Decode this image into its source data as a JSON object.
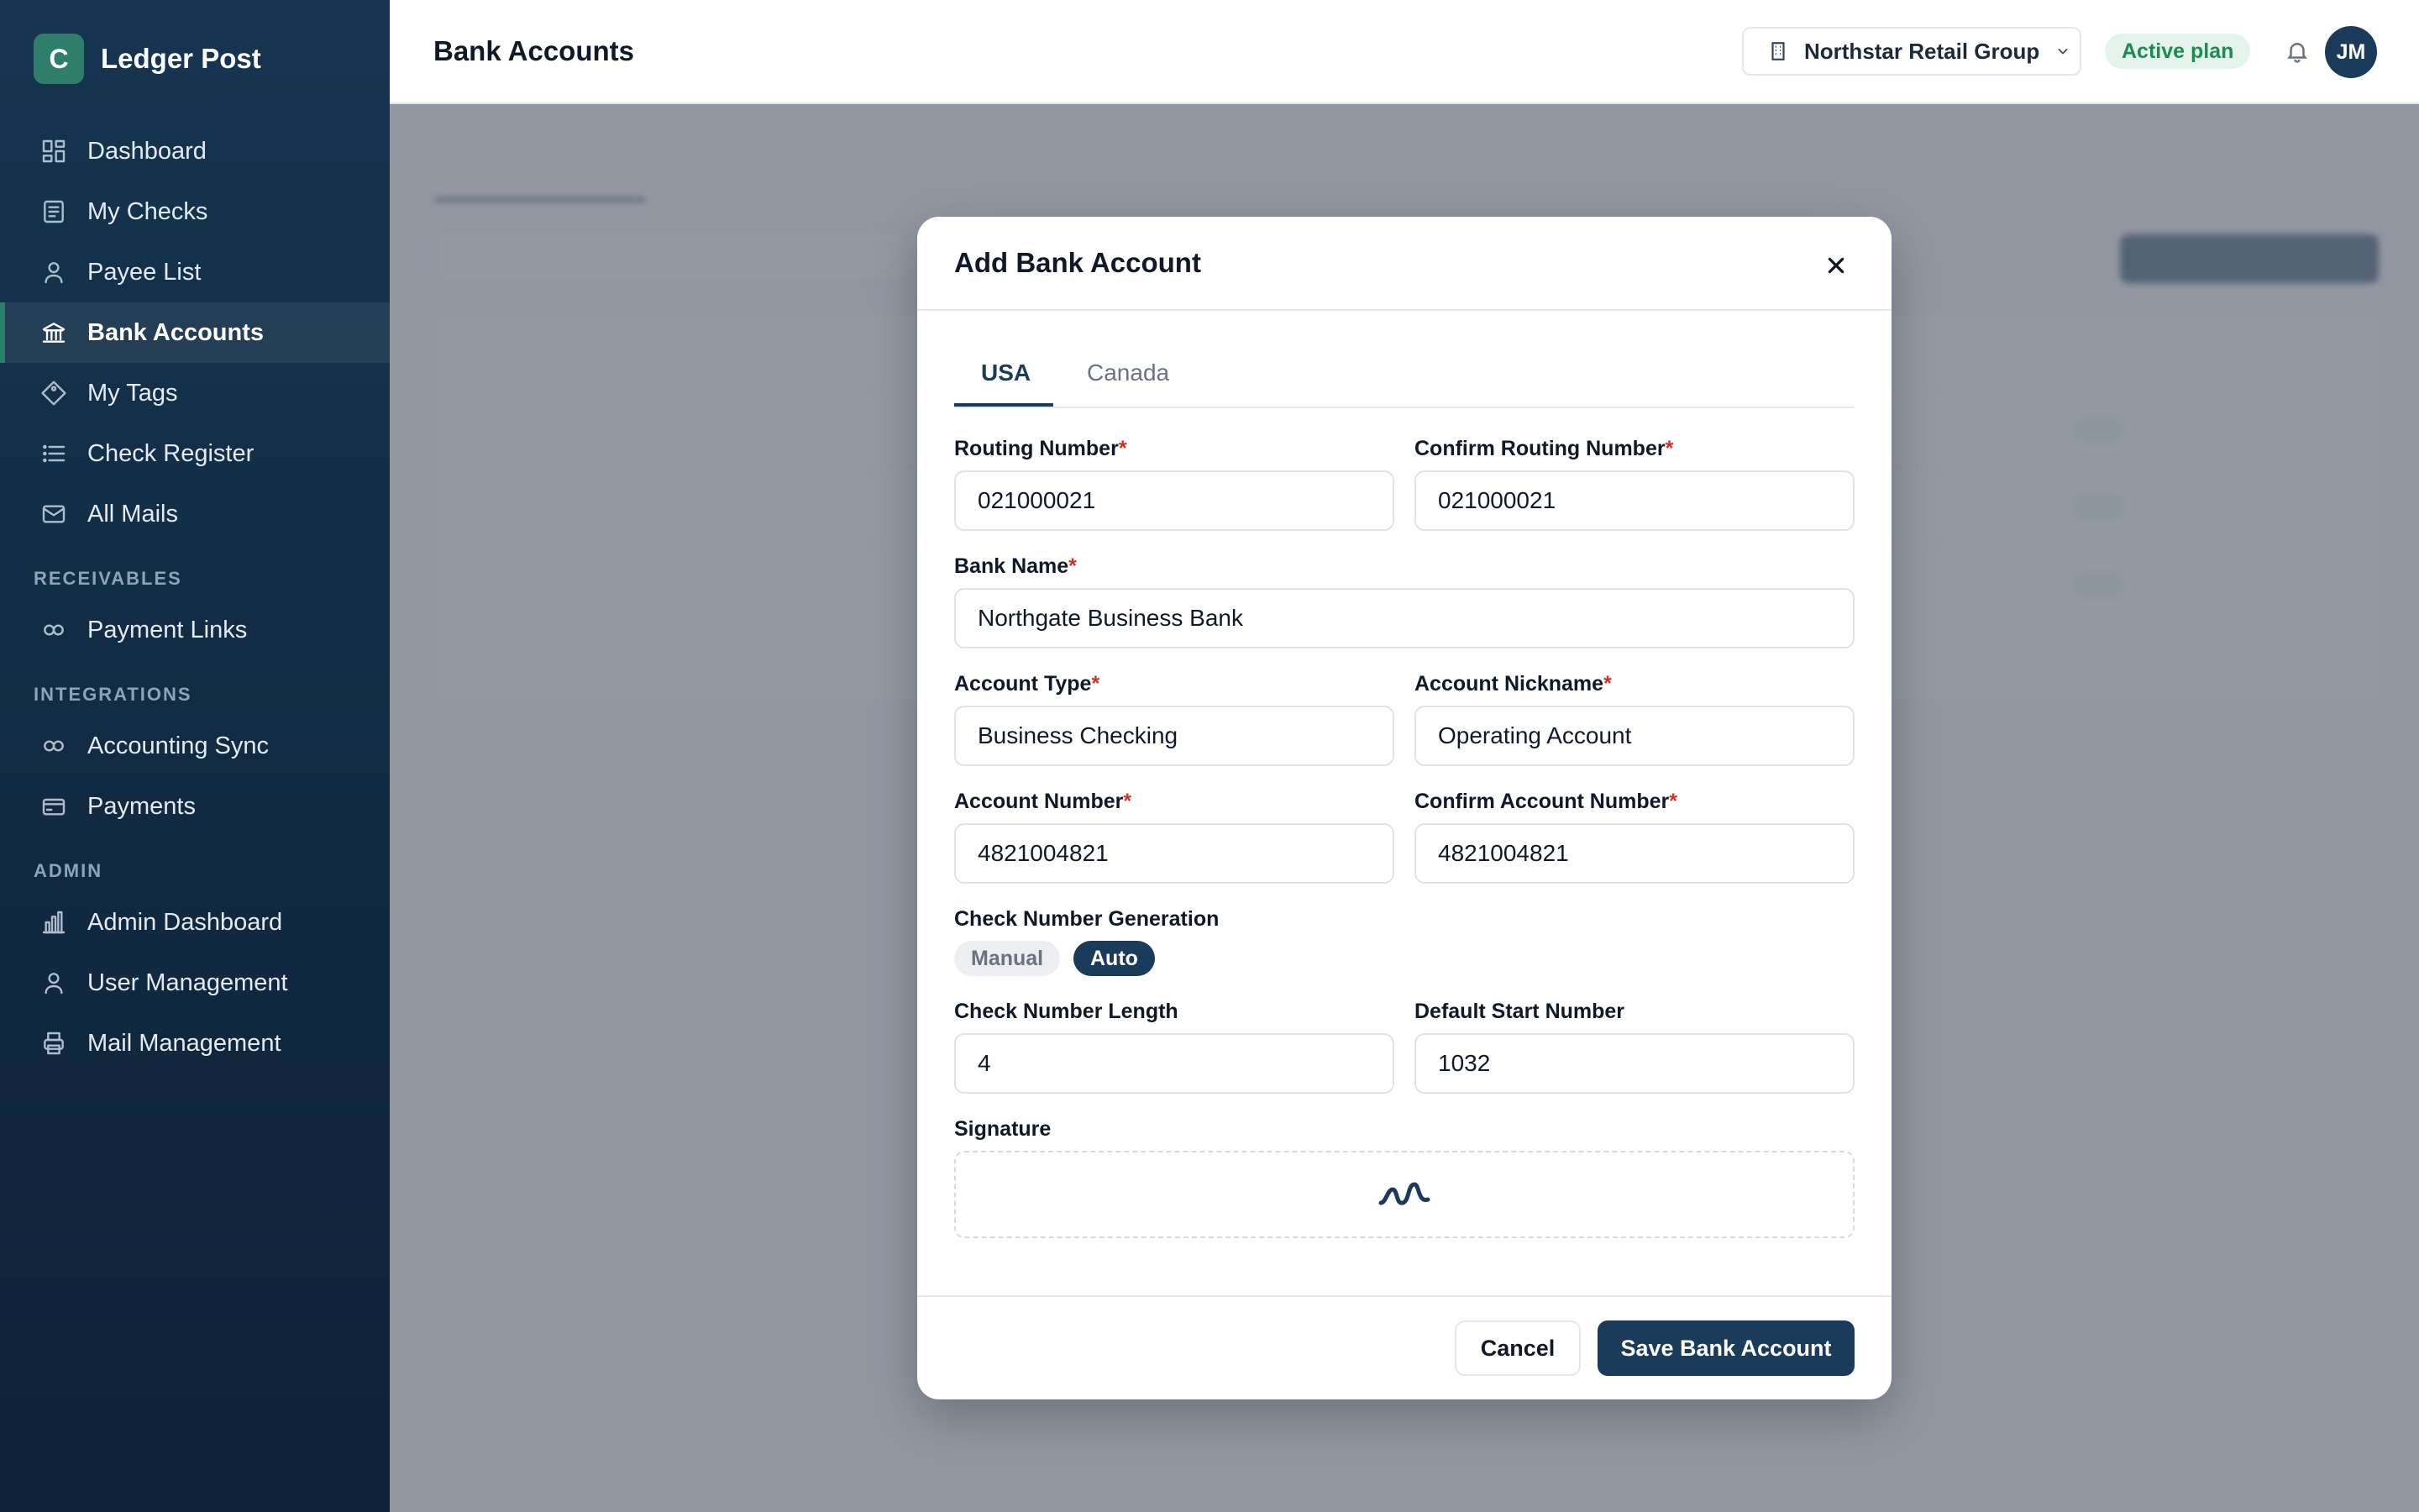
{
  "app": {
    "logo_letter": "C",
    "name": "Ledger Post"
  },
  "sidebar": {
    "items": [
      {
        "label": "Dashboard",
        "icon": "dashboard-icon"
      },
      {
        "label": "My Checks",
        "icon": "check-document-icon"
      },
      {
        "label": "Payee List",
        "icon": "user-icon"
      },
      {
        "label": "Bank Accounts",
        "icon": "bank-icon",
        "active": true
      },
      {
        "label": "My Tags",
        "icon": "tag-icon"
      },
      {
        "label": "Check Register",
        "icon": "list-icon"
      },
      {
        "label": "All Mails",
        "icon": "mail-icon"
      }
    ],
    "sections": {
      "receivables": {
        "title": "RECEIVABLES",
        "items": [
          {
            "label": "Payment Links",
            "icon": "link-icon"
          }
        ]
      },
      "integrations": {
        "title": "INTEGRATIONS",
        "items": [
          {
            "label": "Accounting Sync",
            "icon": "sync-icon"
          },
          {
            "label": "Payments",
            "icon": "card-icon"
          }
        ]
      },
      "admin": {
        "title": "ADMIN",
        "items": [
          {
            "label": "Admin Dashboard",
            "icon": "bar-chart-icon"
          },
          {
            "label": "User Management",
            "icon": "user-icon"
          },
          {
            "label": "Mail Management",
            "icon": "printer-icon"
          }
        ]
      }
    }
  },
  "header": {
    "title": "Bank Accounts",
    "org_name": "Northstar Retail Group",
    "plan_badge": "Active plan",
    "avatar_initials": "JM"
  },
  "modal": {
    "title": "Add Bank Account",
    "tabs": [
      "USA",
      "Canada"
    ],
    "active_tab": "USA",
    "fields": {
      "routing_number": {
        "label": "Routing Number",
        "value": "021000021"
      },
      "confirm_routing_number": {
        "label": "Confirm Routing Number",
        "value": "021000021"
      },
      "bank_name": {
        "label": "Bank Name",
        "value": "Northgate Business Bank"
      },
      "account_type": {
        "label": "Account Type",
        "value": "Business Checking"
      },
      "account_nickname": {
        "label": "Account Nickname",
        "value": "Operating Account"
      },
      "account_number": {
        "label": "Account Number",
        "value": "4821004821"
      },
      "confirm_account_number": {
        "label": "Confirm Account Number",
        "value": "4821004821"
      },
      "check_number_length": {
        "label": "Check Number Length",
        "value": "4"
      },
      "default_start_number": {
        "label": "Default Start Number",
        "value": "1032"
      }
    },
    "required_marker": "*",
    "check_generation": {
      "label": "Check Number Generation",
      "options": [
        "Manual",
        "Auto"
      ],
      "selected": "Auto"
    },
    "signature_label": "Signature",
    "cancel_label": "Cancel",
    "save_label": "Save Bank Account"
  },
  "colors": {
    "brand_green": "#2f7d6b",
    "primary_navy": "#1b3b5a",
    "required_red": "#d92d20",
    "badge_green": "#1e8a55"
  }
}
